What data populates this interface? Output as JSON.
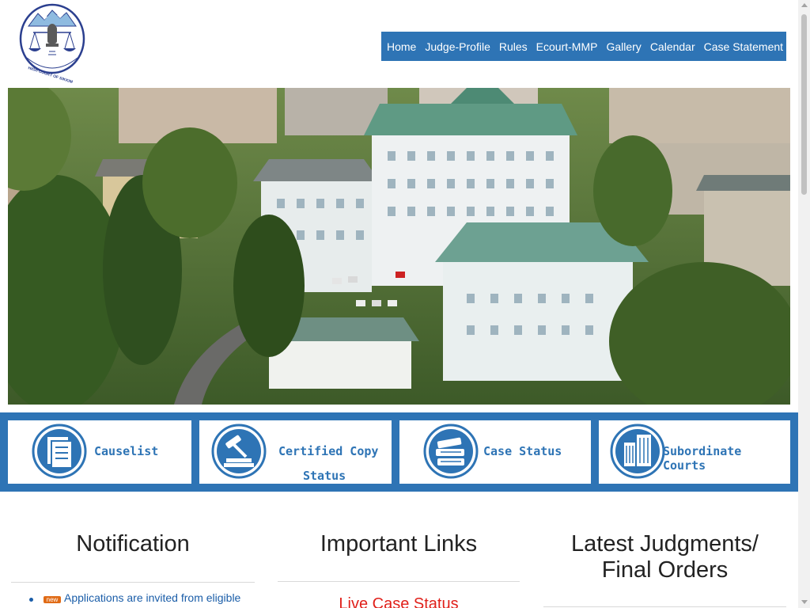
{
  "header": {
    "logo_text": "HIGH COURT OF SIKKIM",
    "nav": [
      "Home",
      "Judge-Profile",
      "Rules",
      "Ecourt-MMP",
      "Gallery",
      "Calendar",
      "Case Statement"
    ]
  },
  "quick_links": [
    {
      "label": "Causelist",
      "icon": "document-list-icon"
    },
    {
      "label_line1": "Certified Copy",
      "label_line2": "Status",
      "icon": "gavel-icon"
    },
    {
      "label": "Case Status",
      "icon": "books-icon"
    },
    {
      "label": "Subordinate Courts",
      "icon": "building-icon"
    }
  ],
  "sections": {
    "notification": {
      "title": "Notification",
      "badge": "new",
      "first_item": "Applications are invited from eligible"
    },
    "important_links": {
      "title": "Important Links",
      "first_item": "Live Case Status"
    },
    "judgments": {
      "title_line1": "Latest Judgments/",
      "title_line2": "Final Orders"
    }
  },
  "colors": {
    "brand_blue": "#2e74b5",
    "link_blue": "#1a5da8",
    "live_red": "#e0201a"
  }
}
